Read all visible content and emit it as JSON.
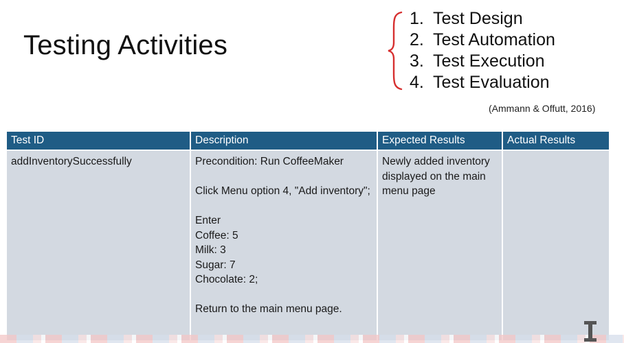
{
  "slide": {
    "title": "Testing Activities",
    "activities": [
      {
        "num": "1.",
        "label": "Test  Design"
      },
      {
        "num": "2.",
        "label": "Test Automation"
      },
      {
        "num": "3.",
        "label": "Test  Execution"
      },
      {
        "num": "4.",
        "label": "Test Evaluation"
      }
    ],
    "citation": "(Ammann & Offutt, 2016)"
  },
  "table": {
    "headers": [
      "Test ID",
      "Description",
      "Expected Results",
      "Actual Results"
    ],
    "row": {
      "test_id": "addInventorySuccessfully",
      "description": {
        "precondition": "Precondition: Run CoffeeMaker",
        "step_click": "Click Menu option 4, \"Add inventory\";",
        "enter": "Enter",
        "coffee": "Coffee: 5",
        "milk": "Milk: 3",
        "sugar": "Sugar: 7",
        "chocolate": "Chocolate: 2;",
        "return": "Return to the main menu page."
      },
      "expected": "Newly added inventory displayed on the main menu page",
      "actual": ""
    }
  },
  "colors": {
    "header_bg": "#1f5c85",
    "cell_bg": "#d3d9e1",
    "brace": "#d62f2f"
  },
  "icons": {
    "brace": "curly-brace",
    "cursor": "text-cursor-icon"
  }
}
